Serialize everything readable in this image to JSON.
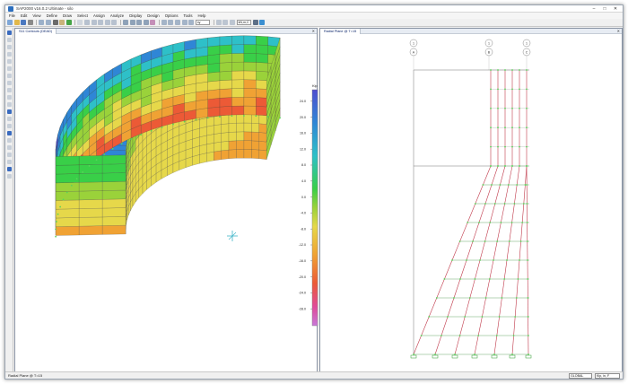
{
  "window": {
    "title": "SAP2000 v16.0.2 Ultimate - silo",
    "min": "–",
    "max": "□",
    "close": "✕"
  },
  "menu": [
    "File",
    "Edit",
    "View",
    "Define",
    "Draw",
    "Select",
    "Assign",
    "Analyze",
    "Display",
    "Design",
    "Options",
    "Tools",
    "Help"
  ],
  "toolbar": {
    "units_label": "kN,m,C",
    "view_label": "xy"
  },
  "left_panel": {
    "tab": "S11 Contours (DEAD)",
    "legend": {
      "unit": "Kip",
      "ticks": [
        "24.0",
        "20.0",
        "16.0",
        "12.0",
        "8.0",
        "4.0",
        "0.0",
        "-4.0",
        "-8.0",
        "-12.0",
        "-16.0",
        "-20.0",
        "-24.0",
        "-28.0"
      ]
    }
  },
  "right_panel": {
    "tab": "Radial Plane @ T=15",
    "grid_bubbles": [
      {
        "top": "1",
        "bottom": "A"
      },
      {
        "top": "1",
        "bottom": "B"
      },
      {
        "top": "1",
        "bottom": "C"
      }
    ]
  },
  "status": {
    "message": "Radial Plane @ T=15",
    "coord_system": "GLOBAL",
    "units": "Kip, in, F"
  },
  "colors": {
    "frame": "#f0f0f0",
    "accent": "#0a246a",
    "mesh_line": "#3a3a3a",
    "ring_line": "#c0394a",
    "joint": "#5ad35a"
  }
}
